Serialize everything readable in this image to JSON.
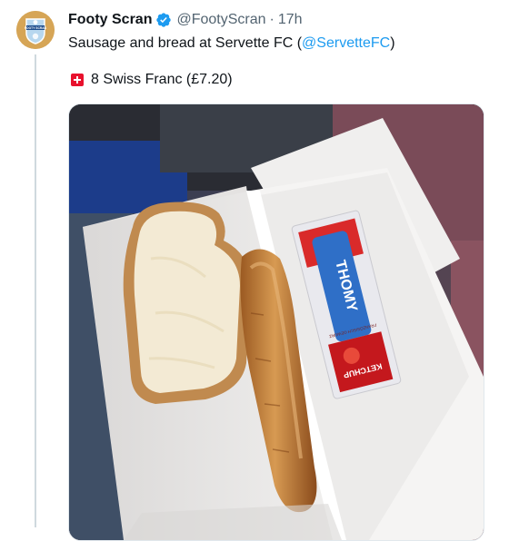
{
  "tweet": {
    "author_name": "Footy Scran",
    "author_handle": "@FootyScran",
    "separator": "·",
    "time": "17h",
    "text_before": "Sausage and bread at Servette FC (",
    "mention": "@ServetteFC",
    "text_after": ")",
    "price_text": "8 Swiss Franc (£7.20)",
    "verified": true
  },
  "avatar": {
    "label": "FOOTY SCRAN"
  },
  "media": {
    "packet_brand": "THOMY",
    "packet_product": "KETCHUP",
    "packet_tagline": "FRANZÖSISCH GEWÜRZ"
  },
  "icons": {
    "verified": "verified-badge-icon",
    "flag": "swiss-flag-icon"
  },
  "colors": {
    "accent": "#1d9bf0",
    "secondary_text": "#536471",
    "swiss_red": "#e8112d"
  }
}
